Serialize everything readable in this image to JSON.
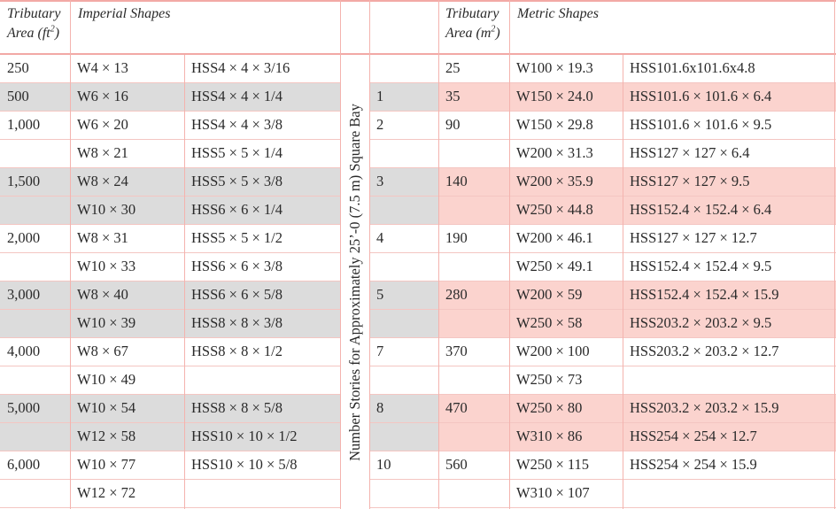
{
  "header": {
    "imperial_area_line1": "Tributary",
    "imperial_area_line2": "Area (ft",
    "imperial_area_sup": "2",
    "imperial_area_close": ")",
    "imperial_shapes": "Imperial Shapes",
    "metric_area_line1": "Tributary",
    "metric_area_line2": "Area (m",
    "metric_area_sup": "2",
    "metric_area_close": ")",
    "metric_shapes": "Metric Shapes"
  },
  "stories_label": "Number Stories for Approximately 25’-0 (7.5 m) Square Bay",
  "colors": {
    "grey_fill": "#dcdcdc",
    "pink_fill": "#fbd3ce",
    "border": "#f4b3ae"
  },
  "rows": [
    {
      "imp_area": "250",
      "imp_w": "W4 × 13",
      "imp_hss": "HSS4 × 4 × 3/16",
      "stories": "",
      "met_area": "25",
      "met_w": "W100 × 19.3",
      "met_hss": "HSS101.6x101.6x4.8",
      "shade": "none"
    },
    {
      "imp_area": "500",
      "imp_w": "W6 × 16",
      "imp_hss": "HSS4 × 4 × 1/4",
      "stories": "1",
      "met_area": "35",
      "met_w": "W150 × 24.0",
      "met_hss": "HSS101.6 × 101.6 × 6.4",
      "shade": "shaded"
    },
    {
      "imp_area": "1,000",
      "imp_w": "W6 × 20",
      "imp_hss": "HSS4 × 4 × 3/8",
      "stories": "2",
      "met_area": "90",
      "met_w": "W150 × 29.8",
      "met_hss": "HSS101.6 × 101.6 × 9.5",
      "shade": "none"
    },
    {
      "imp_area": "",
      "imp_w": "W8 × 21",
      "imp_hss": "HSS5 × 5 × 1/4",
      "stories": "",
      "met_area": "",
      "met_w": "W200 × 31.3",
      "met_hss": "HSS127 × 127 × 6.4",
      "shade": "none"
    },
    {
      "imp_area": "1,500",
      "imp_w": "W8 × 24",
      "imp_hss": "HSS5 × 5 × 3/8",
      "stories": "3",
      "met_area": "140",
      "met_w": "W200 × 35.9",
      "met_hss": "HSS127 × 127 × 9.5",
      "shade": "shaded"
    },
    {
      "imp_area": "",
      "imp_w": "W10 × 30",
      "imp_hss": "HSS6 × 6 × 1/4",
      "stories": "",
      "met_area": "",
      "met_w": "W250 × 44.8",
      "met_hss": "HSS152.4 × 152.4 × 6.4",
      "shade": "shaded"
    },
    {
      "imp_area": "2,000",
      "imp_w": "W8 × 31",
      "imp_hss": "HSS5 × 5 × 1/2",
      "stories": "4",
      "met_area": "190",
      "met_w": "W200 × 46.1",
      "met_hss": "HSS127 × 127 × 12.7",
      "shade": "none"
    },
    {
      "imp_area": "",
      "imp_w": "W10 × 33",
      "imp_hss": "HSS6 × 6 × 3/8",
      "stories": "",
      "met_area": "",
      "met_w": "W250 × 49.1",
      "met_hss": "HSS152.4 × 152.4 × 9.5",
      "shade": "none"
    },
    {
      "imp_area": "3,000",
      "imp_w": "W8 × 40",
      "imp_hss": "HSS6 × 6 × 5/8",
      "stories": "5",
      "met_area": "280",
      "met_w": "W200 × 59",
      "met_hss": "HSS152.4 × 152.4 × 15.9",
      "shade": "shaded"
    },
    {
      "imp_area": "",
      "imp_w": "W10 × 39",
      "imp_hss": "HSS8 × 8 × 3/8",
      "stories": "",
      "met_area": "",
      "met_w": "W250 × 58",
      "met_hss": "HSS203.2 × 203.2 × 9.5",
      "shade": "shaded"
    },
    {
      "imp_area": "4,000",
      "imp_w": "W8 × 67",
      "imp_hss": "HSS8 × 8 × 1/2",
      "stories": "7",
      "met_area": "370",
      "met_w": "W200 × 100",
      "met_hss": "HSS203.2 × 203.2 × 12.7",
      "shade": "none"
    },
    {
      "imp_area": "",
      "imp_w": "W10 × 49",
      "imp_hss": "",
      "stories": "",
      "met_area": "",
      "met_w": "W250 × 73",
      "met_hss": "",
      "shade": "none"
    },
    {
      "imp_area": "5,000",
      "imp_w": "W10 × 54",
      "imp_hss": "HSS8 × 8 × 5/8",
      "stories": "8",
      "met_area": "470",
      "met_w": "W250 × 80",
      "met_hss": "HSS203.2 × 203.2 × 15.9",
      "shade": "shaded"
    },
    {
      "imp_area": "",
      "imp_w": "W12 × 58",
      "imp_hss": "HSS10 × 10 × 1/2",
      "stories": "",
      "met_area": "",
      "met_w": "W310 × 86",
      "met_hss": "HSS254 × 254 × 12.7",
      "shade": "shaded"
    },
    {
      "imp_area": "6,000",
      "imp_w": "W10 × 77",
      "imp_hss": "HSS10 × 10 × 5/8",
      "stories": "10",
      "met_area": "560",
      "met_w": "W250 × 115",
      "met_hss": "HSS254 × 254 × 15.9",
      "shade": "none"
    },
    {
      "imp_area": "",
      "imp_w": "W12 × 72",
      "imp_hss": "",
      "stories": "",
      "met_area": "",
      "met_w": "W310 × 107",
      "met_hss": "",
      "shade": "none"
    }
  ]
}
